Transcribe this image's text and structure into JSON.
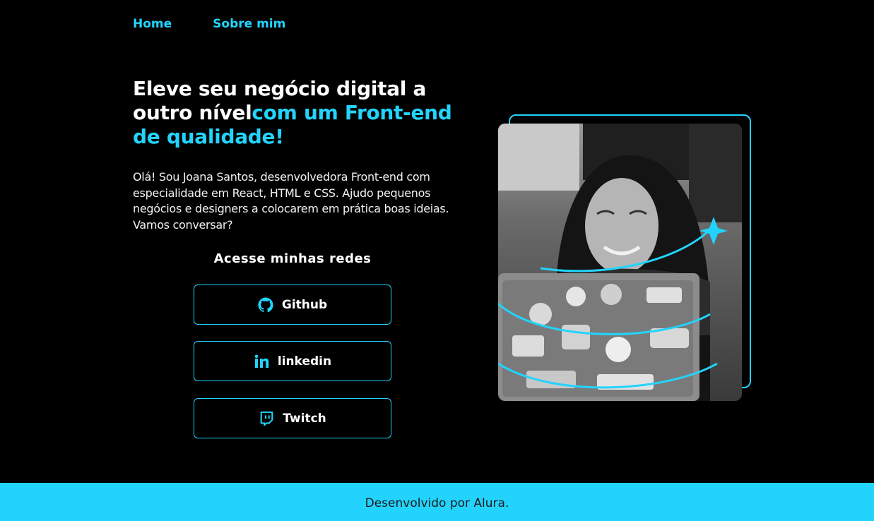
{
  "nav": {
    "home": "Home",
    "about": "Sobre mim"
  },
  "hero": {
    "title_part1": "Eleve seu negócio digital a outro nível",
    "title_part2": "com um Front-end de qualidade!",
    "intro": "Olá! Sou Joana Santos, desenvolvedora Front-end com especialidade em React, HTML e CSS. Ajudo pequenos negócios e designers a colocarem em prática boas ideias. Vamos conversar?"
  },
  "social": {
    "title": "Acesse minhas redes",
    "buttons": [
      {
        "label": "Github",
        "icon": "github-icon"
      },
      {
        "label": "linkedin",
        "icon": "linkedin-icon"
      },
      {
        "label": "Twitch",
        "icon": "twitch-icon"
      }
    ]
  },
  "footer": {
    "text": "Desenvolvido por Alura."
  },
  "colors": {
    "accent": "#22d4fd",
    "background": "#000000",
    "text": "#ffffff"
  }
}
